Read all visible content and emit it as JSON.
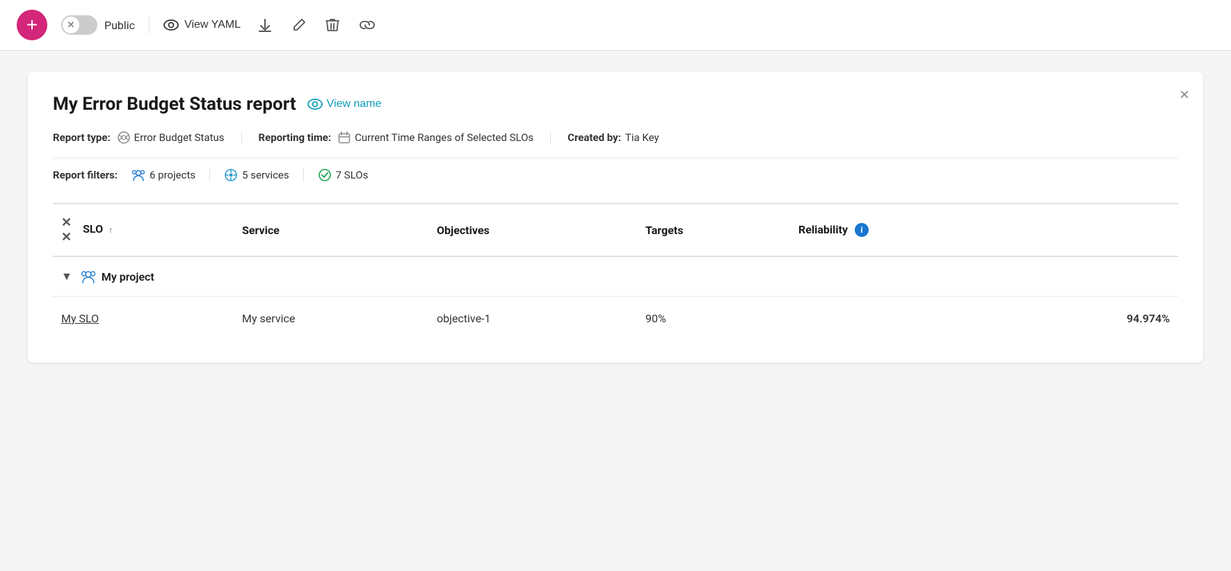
{
  "toolbar": {
    "add_button_label": "+",
    "toggle_label": "Public",
    "toggle_active": false,
    "view_yaml_label": "View YAML",
    "download_icon": "⬇",
    "edit_icon": "✏",
    "delete_icon": "🗑",
    "link_icon": "🔗"
  },
  "report": {
    "title": "My Error Budget Status report",
    "view_name_label": "View name",
    "close_icon": "×",
    "meta": {
      "report_type_label": "Report type:",
      "report_type_value": "Error Budget Status",
      "reporting_time_label": "Reporting time:",
      "reporting_time_value": "Current Time Ranges of Selected SLOs",
      "created_by_label": "Created by:",
      "created_by_value": "Tia Key"
    },
    "filters": {
      "label": "Report filters:",
      "projects_count": "6 projects",
      "services_count": "5 services",
      "slos_count": "7 SLOs"
    },
    "table": {
      "columns": {
        "slo": "SLO",
        "service": "Service",
        "objectives": "Objectives",
        "targets": "Targets",
        "reliability": "Reliability"
      },
      "project_row": {
        "name": "My project"
      },
      "data_rows": [
        {
          "slo": "My SLO",
          "service": "My service",
          "objectives": "objective-1",
          "targets": "90%",
          "reliability": "94.974%"
        }
      ]
    }
  }
}
